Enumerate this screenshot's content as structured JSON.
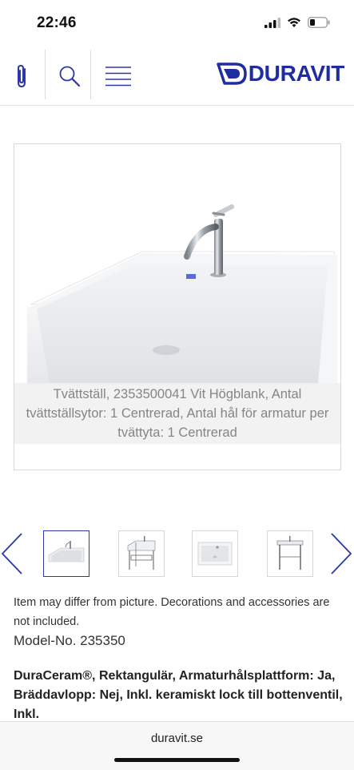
{
  "status_bar": {
    "time": "22:46"
  },
  "header": {
    "icons": [
      "paperclip-icon",
      "search-icon",
      "menu-icon"
    ],
    "logo_text": "DURAVIT",
    "brand_color": "#1f2da0"
  },
  "product": {
    "image_caption": "Tvättställ, 2353500041 Vit Högblank, Antal tvättställsytor: 1 Centrerad, Antal hål för armatur per tvättyta: 1 Centrerad",
    "thumbnails": [
      {
        "name": "washbasin-front-thumbnail",
        "selected": true
      },
      {
        "name": "washbasin-with-frame-thumbnail",
        "selected": false
      },
      {
        "name": "washbasin-top-view-thumbnail",
        "selected": false
      },
      {
        "name": "console-frame-thumbnail",
        "selected": false
      }
    ],
    "disclaimer": "Item may differ from picture. Decorations and accessories are not included.",
    "model_number": "Model-No. 235350",
    "description": "DuraCeram®, Rektangulär, Armaturhålsplattform: Ja, Bräddavlopp: Nej, Inkl. keramiskt lock till bottenventil, Inkl."
  },
  "browser": {
    "url": "duravit.se"
  }
}
